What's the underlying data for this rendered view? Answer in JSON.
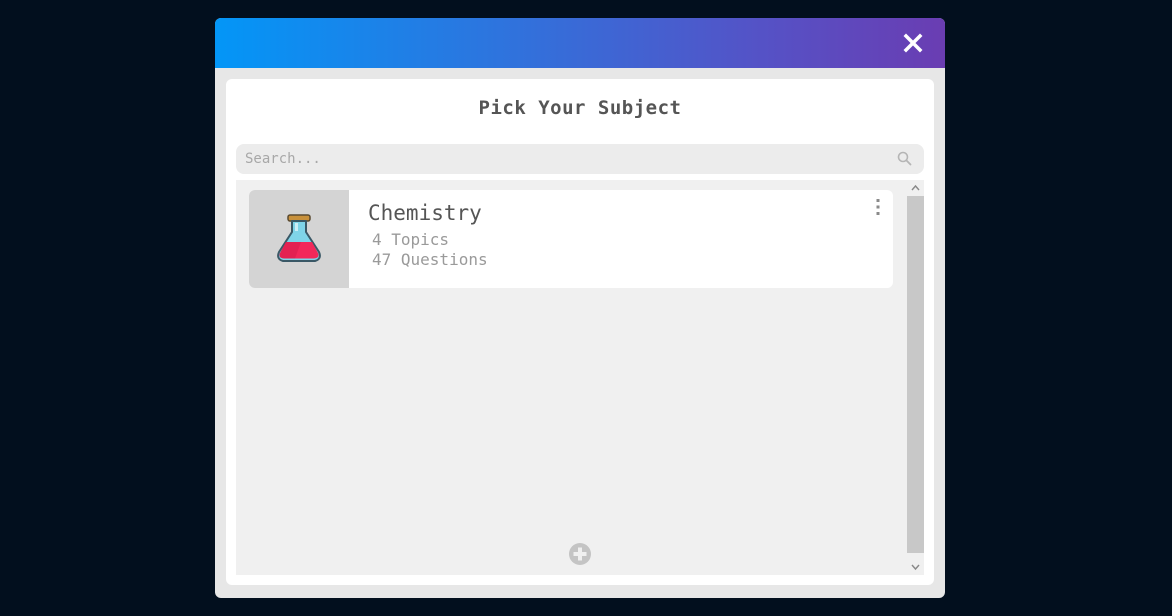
{
  "modal": {
    "title": "Pick Your Subject",
    "header_gradient": [
      "#0396f7",
      "#6a3db2"
    ],
    "close_icon": "close-icon"
  },
  "search": {
    "placeholder": "Search...",
    "value": "",
    "icon": "search-icon"
  },
  "subjects": [
    {
      "name": "Chemistry",
      "topics": "4 Topics",
      "questions": "47 Questions",
      "icon": "flask-icon",
      "menu_icon": "kebab-menu-icon"
    }
  ],
  "add_button": {
    "icon": "plus-circle-icon"
  },
  "colors": {
    "background": "#020f1e",
    "accent_flask": "#f2285a"
  }
}
